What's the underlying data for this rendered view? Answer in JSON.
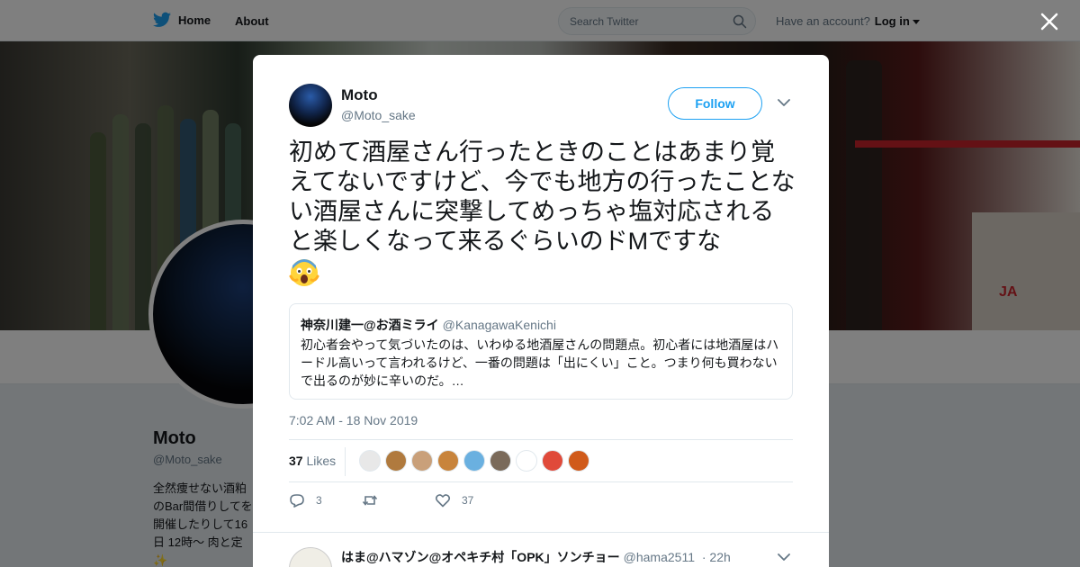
{
  "topbar": {
    "home_label": "Home",
    "about_label": "About",
    "search_placeholder": "Search Twitter",
    "account_prompt": "Have an account?",
    "login_label": "Log in"
  },
  "colors": {
    "twitter_blue": "#1da1f2",
    "text_primary": "#14171a",
    "text_secondary": "#657786",
    "border": "#e1e8ed"
  },
  "profile": {
    "name": "Moto",
    "handle": "@Moto_sake",
    "bio": "全然痩せない酒粕のBar間借りしてを開催したりして16日 12時～ 肉と定✨"
  },
  "tweet": {
    "author_name": "Moto",
    "author_handle": "@Moto_sake",
    "follow_label": "Follow",
    "text": "初めて酒屋さん行ったときのことはあまり覚えてないですけど、今でも地方の行ったことない酒屋さんに突撃してめっちゃ塩対応されると楽しくなって来るぐらいのドMですな",
    "emoji": "face-screaming-in-fear",
    "quote": {
      "author_name": "神奈川建一@お酒ミライ",
      "author_handle": "@KanagawaKenichi",
      "text": "初心者会やって気づいたのは、いわゆる地酒屋さんの問題点。初心者には地酒屋はハードル高いって言われるけど、一番の問題は「出にくい」こと。つまり何も買わないで出るのが妙に辛いのだ。…"
    },
    "timestamp": "7:02 AM - 18 Nov 2019",
    "likes_count": "37",
    "likes_label": "Likes",
    "likers": [
      "#e8e8e8",
      "#b07a3e",
      "#c9a07a",
      "#c8843c",
      "#6ab0e0",
      "#7a6a5a",
      "#ffffff",
      "#e04a3a",
      "#d05a1a"
    ],
    "actions": {
      "reply_count": "3",
      "retweet_count": "",
      "like_count": "37"
    }
  },
  "reply": {
    "author_name": "はま@ハマゾン@オペキチ村「OPK」ソンチョー",
    "author_handle": "@hama2511",
    "time": "· 22h"
  }
}
